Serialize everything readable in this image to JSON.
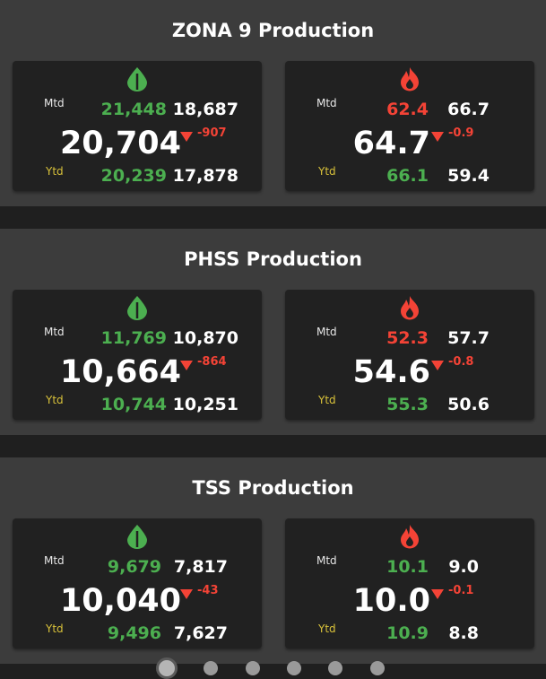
{
  "labels": {
    "mtd": "Mtd",
    "ytd": "Ytd"
  },
  "colors": {
    "green": "#4caf50",
    "red": "#f44336",
    "ytd_label": "#d9c23a",
    "card": "#212121",
    "section": "#3c3c3c"
  },
  "icons": {
    "left": "oil-drop-icon",
    "right": "flame-icon"
  },
  "sections": [
    {
      "title": "ZONA 9 Production",
      "oil": {
        "mtd_actual": "21,448",
        "mtd_target": "18,687",
        "current": "20,704",
        "delta": "-907",
        "ytd_actual": "20,239",
        "ytd_target": "17,878"
      },
      "gas": {
        "mtd_actual": "62.4",
        "mtd_target": "66.7",
        "current": "64.7",
        "delta": "-0.9",
        "ytd_actual": "66.1",
        "ytd_target": "59.4"
      }
    },
    {
      "title": "PHSS Production",
      "oil": {
        "mtd_actual": "11,769",
        "mtd_target": "10,870",
        "current": "10,664",
        "delta": "-864",
        "ytd_actual": "10,744",
        "ytd_target": "10,251"
      },
      "gas": {
        "mtd_actual": "52.3",
        "mtd_target": "57.7",
        "current": "54.6",
        "delta": "-0.8",
        "ytd_actual": "55.3",
        "ytd_target": "50.6"
      }
    },
    {
      "title": "TSS Production",
      "oil": {
        "mtd_actual": "9,679",
        "mtd_target": "7,817",
        "current": "10,040",
        "delta": "-43",
        "ytd_actual": "9,496",
        "ytd_target": "7,627"
      },
      "gas": {
        "mtd_actual": "10.1",
        "mtd_target": "9.0",
        "current": "10.0",
        "delta": "-0.1",
        "ytd_actual": "10.9",
        "ytd_target": "8.8"
      }
    }
  ],
  "pagination": {
    "total": 6,
    "active": 1
  }
}
